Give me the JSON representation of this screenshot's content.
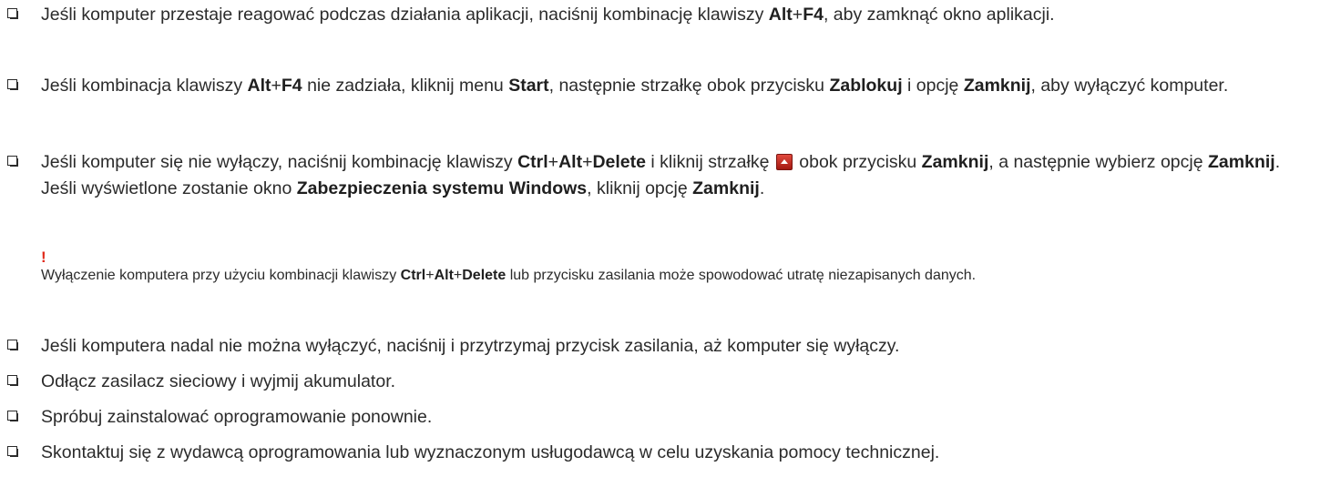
{
  "items": [
    {
      "pre": "Jeśli komputer przestaje reagować podczas działania aplikacji, naciśnij kombinację klawiszy ",
      "k1": "Alt",
      "plus1": "+",
      "k2": "F4",
      "post": ", aby zamknąć okno aplikacji."
    },
    {
      "pre": "Jeśli kombinacja klawiszy ",
      "k1": "Alt",
      "plus1": "+",
      "k2": "F4",
      "mid1": " nie zadziała, kliknij menu ",
      "start": "Start",
      "mid2": ", następnie strzałkę obok przycisku ",
      "lock": "Zablokuj",
      "mid3": " i opcję ",
      "close": "Zamknij",
      "post": ", aby wyłączyć komputer."
    },
    {
      "pre": "Jeśli komputer się nie wyłączy, naciśnij kombinację klawiszy ",
      "k1": "Ctrl",
      "plus1": "+",
      "k2": "Alt",
      "plus2": "+",
      "k3": "Delete",
      "mid1": " i kliknij strzałkę ",
      "mid2": " obok przycisku ",
      "close1": "Zamknij",
      "mid3": ", a następnie wybierz opcję ",
      "close2": "Zamknij",
      "end1": ".",
      "line2_pre": "Jeśli wyświetlone zostanie okno ",
      "window": "Zabezpieczenia systemu Windows",
      "line2_mid": ", kliknij opcję ",
      "close3": "Zamknij",
      "line2_end": "."
    },
    {
      "text": "Jeśli komputera nadal nie można wyłączyć, naciśnij i przytrzymaj przycisk zasilania, aż komputer się wyłączy."
    },
    {
      "text": "Odłącz zasilacz sieciowy i wyjmij akumulator."
    },
    {
      "text": "Spróbuj zainstalować oprogramowanie ponownie."
    },
    {
      "text": "Skontaktuj się z wydawcą oprogramowania lub wyznaczonym usługodawcą w celu uzyskania pomocy technicznej."
    }
  ],
  "warning": {
    "mark": "!",
    "pre": "Wyłączenie komputera przy użyciu kombinacji klawiszy ",
    "k1": "Ctrl",
    "plus1": "+",
    "k2": "Alt",
    "plus2": "+",
    "k3": "Delete",
    "post": " lub przycisku zasilania może spowodować utratę niezapisanych danych."
  },
  "colors": {
    "text": "#2b2b2b",
    "warning_mark": "#e02a1a",
    "arrow_button": "#c4281c"
  },
  "icons": [
    "checkbox-bullet-icon",
    "shutdown-arrow-icon"
  ]
}
